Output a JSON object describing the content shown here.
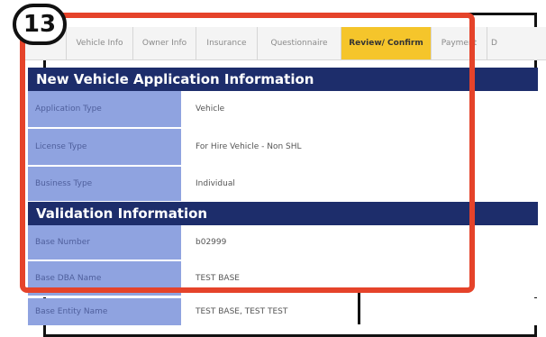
{
  "annotation": {
    "step_number": "13",
    "highlight_color": "#e5432a"
  },
  "tabs": [
    {
      "label": "",
      "active": false
    },
    {
      "label": "Vehicle Info",
      "active": false
    },
    {
      "label": "Owner Info",
      "active": false
    },
    {
      "label": "Insurance",
      "active": false
    },
    {
      "label": "Questionnaire",
      "active": false
    },
    {
      "label": "Review/ Confirm",
      "active": true
    },
    {
      "label": "Payment",
      "active": false
    },
    {
      "label": "D",
      "active": false
    }
  ],
  "sections": {
    "vehicle": {
      "title": "New Vehicle Application Information",
      "rows": [
        {
          "label": "Application Type",
          "value": "Vehicle"
        },
        {
          "label": "License Type",
          "value": "For Hire Vehicle - Non SHL"
        },
        {
          "label": "Business Type",
          "value": "Individual"
        }
      ]
    },
    "validation": {
      "title": "Validation Information",
      "rows": [
        {
          "label": "Base Number",
          "value": "b02999"
        },
        {
          "label": "Base DBA Name",
          "value": "TEST BASE"
        },
        {
          "label": "Base Entity Name",
          "value": "TEST BASE, TEST TEST"
        }
      ]
    }
  },
  "colors": {
    "section_header": "#1d2d6b",
    "label_cell": "#8fa3e0",
    "active_tab": "#f5c52b"
  }
}
